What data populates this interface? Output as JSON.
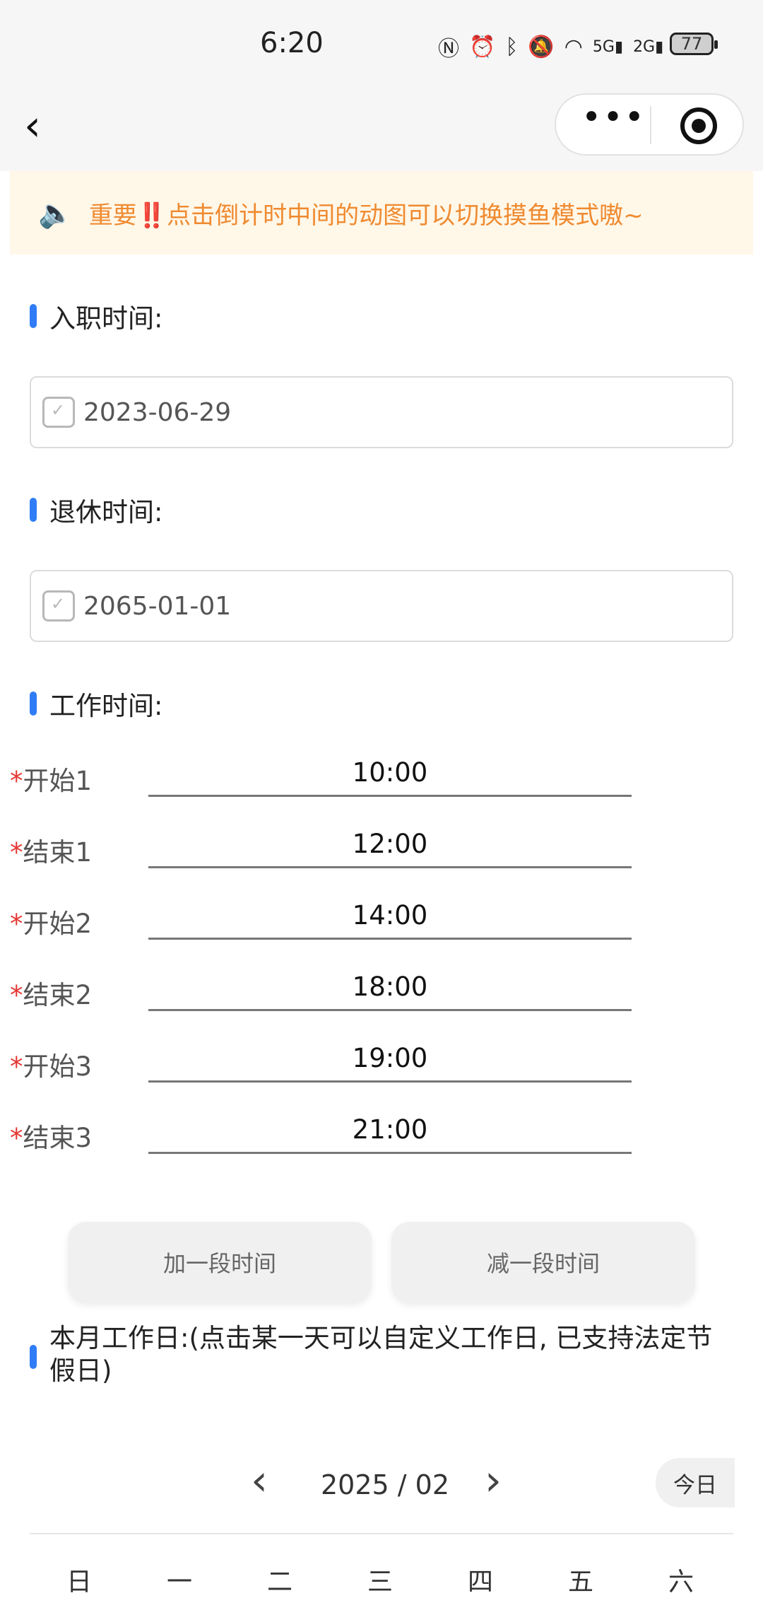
{
  "status_bar": {
    "time": "6:20",
    "icons": [
      "nfc-icon",
      "alarm-icon",
      "bluetooth-icon",
      "mute-icon",
      "wifi-icon",
      "signal-5g-icon",
      "signal-2g-icon"
    ],
    "battery": "77"
  },
  "nav": {
    "back_icon": "chevron-left-icon",
    "more_icon": "more-dots-icon",
    "target_icon": "record-target-icon"
  },
  "notice": {
    "icon": "speaker-icon",
    "text": "重要‼️点击倒计时中间的动图可以切换摸鱼模式嗷~"
  },
  "hire_date": {
    "label": "入职时间:",
    "value": "2023-06-29"
  },
  "retire_date": {
    "label": "退休时间:",
    "value": "2065-01-01"
  },
  "work_time": {
    "label": "工作时间:",
    "rows": [
      {
        "label": "开始1",
        "value": "10:00"
      },
      {
        "label": "结束1",
        "value": "12:00"
      },
      {
        "label": "开始2",
        "value": "14:00"
      },
      {
        "label": "结束2",
        "value": "18:00"
      },
      {
        "label": "开始3",
        "value": "19:00"
      },
      {
        "label": "结束3",
        "value": "21:00"
      }
    ]
  },
  "buttons": {
    "add": "加一段时间",
    "remove": "减一段时间"
  },
  "month_note": "本月工作日:(点击某一天可以自定义工作日, 已支持法定节假日)",
  "calendar": {
    "title": "2025 / 02",
    "today": "今日",
    "weekdays": [
      "日",
      "一",
      "二",
      "三",
      "四",
      "五",
      "六"
    ]
  },
  "colors": {
    "accent": "#2f7cf6",
    "notice_bg": "#fff7e8",
    "notice_text": "#ef8a30",
    "required": "#e53935"
  }
}
